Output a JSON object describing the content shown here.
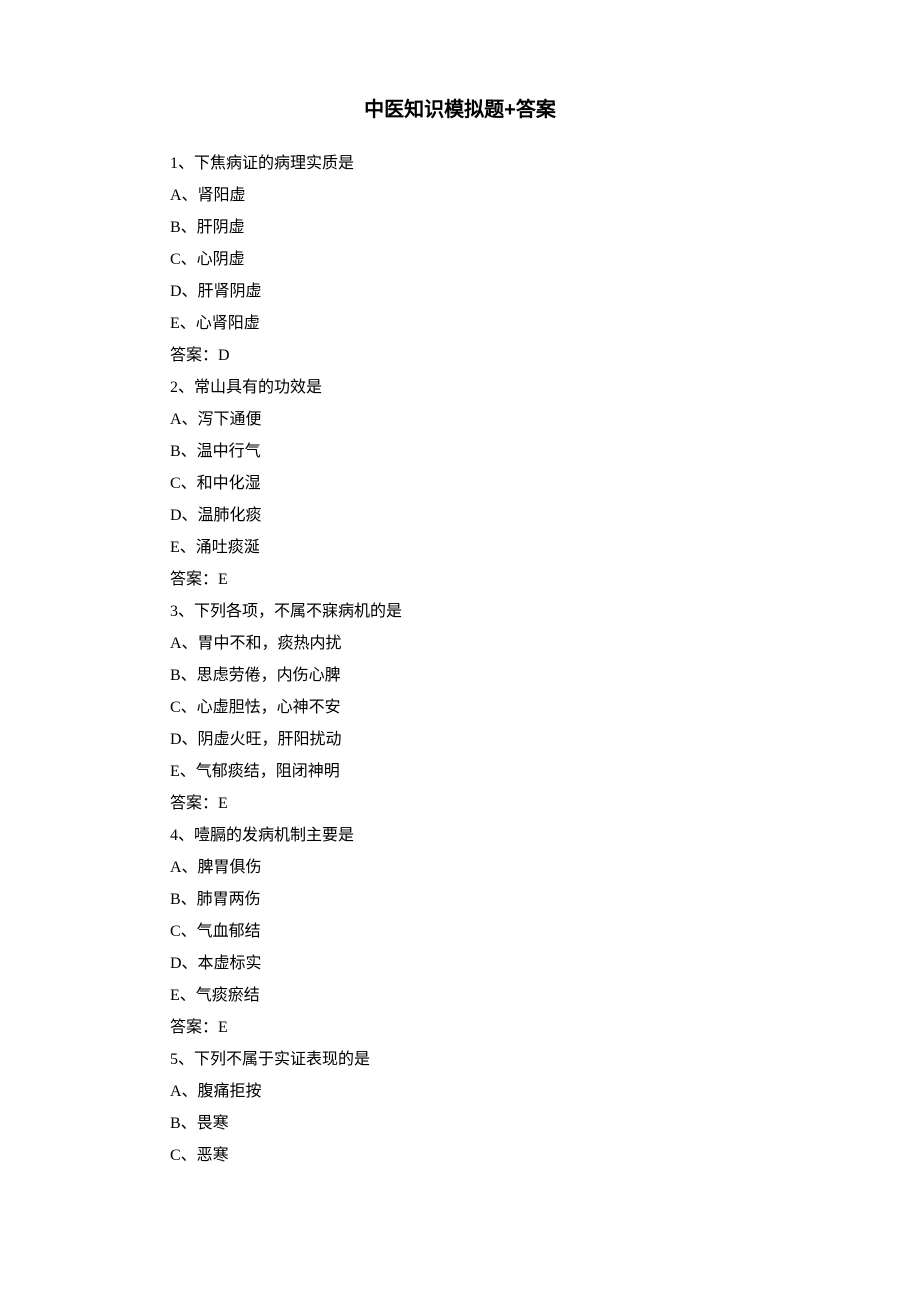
{
  "title": "中医知识模拟题+答案",
  "questions": [
    {
      "number": "1、",
      "stem": "下焦病证的病理实质是",
      "options": [
        "A、肾阳虚",
        "B、肝阴虚",
        "C、心阴虚",
        "D、肝肾阴虚",
        "E、心肾阳虚"
      ],
      "answer": "答案：D"
    },
    {
      "number": "2、",
      "stem": "常山具有的功效是",
      "options": [
        "A、泻下通便",
        "B、温中行气",
        "C、和中化湿",
        "D、温肺化痰",
        "E、涌吐痰涎"
      ],
      "answer": "答案：E"
    },
    {
      "number": "3、",
      "stem": "下列各项，不属不寐病机的是",
      "options": [
        "A、胃中不和，痰热内扰",
        "B、思虑劳倦，内伤心脾",
        "C、心虚胆怯，心神不安",
        "D、阴虚火旺，肝阳扰动",
        "E、气郁痰结，阻闭神明"
      ],
      "answer": "答案：E"
    },
    {
      "number": "4、",
      "stem": "噎膈的发病机制主要是",
      "options": [
        "A、脾胃俱伤",
        "B、肺胃两伤",
        "C、气血郁结",
        "D、本虚标实",
        "E、气痰瘀结"
      ],
      "answer": "答案：E"
    },
    {
      "number": "5、",
      "stem": "下列不属于实证表现的是",
      "options": [
        "A、腹痛拒按",
        "B、畏寒",
        "C、恶寒"
      ],
      "answer": null
    }
  ]
}
